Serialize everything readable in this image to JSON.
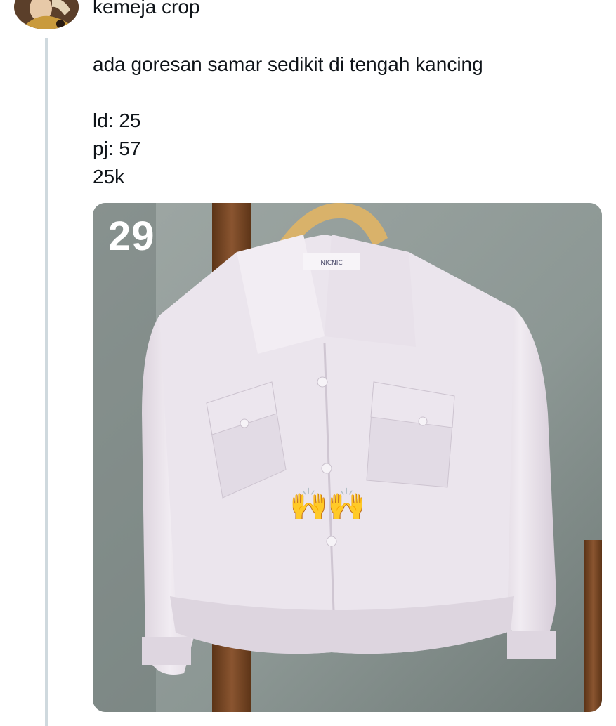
{
  "tweet": {
    "header_text": "kemeja crop",
    "description": "ada goresan samar sedikit di tengah kancing",
    "ld": "ld: 25",
    "pj": "pj: 57",
    "price": "25k"
  },
  "photo": {
    "number_label": "29",
    "tag_text": "NICNIC",
    "emoji": "🙌",
    "colors": {
      "wall": "#8f9a97",
      "shirt": "#ece6ee",
      "hanger": "#d9b26a",
      "rack": "#7a4a26"
    }
  },
  "icons": {
    "avatar": "profile-photo",
    "hands": "raised-hands-emoji"
  }
}
